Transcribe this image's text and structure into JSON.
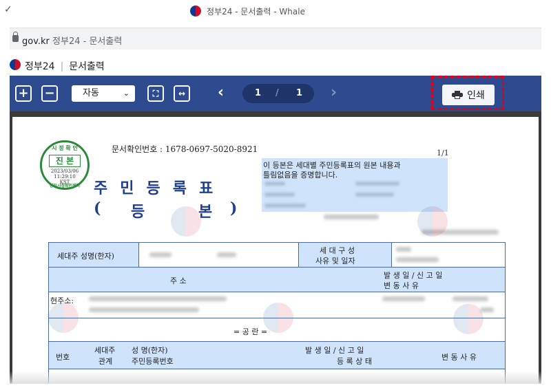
{
  "window": {
    "title": "정부24 - 문서출력 - Whale"
  },
  "address_bar": {
    "host": "gov.kr",
    "rest": " 정부24 - 문서출력"
  },
  "pdf_header": {
    "site": "정부24",
    "page": "문서출력"
  },
  "toolbar": {
    "zoom_in": "+",
    "zoom_out": "−",
    "zoom_select": "자동",
    "current_page": "1",
    "page_separator": "/",
    "total_pages": "1",
    "print_label": "인쇄"
  },
  "document": {
    "confirmation": "문서확인번호 : 1678-0697-5020-8921",
    "page_indicator": "1/1",
    "seal": {
      "top": "시 정 확 인",
      "main": "진 본",
      "date": "2023/03/06",
      "time": "11:29:10",
      "tz": "KST",
      "bottom": "정부시정확인센터"
    },
    "title": "주민등록표",
    "subtitle_open": "(",
    "subtitle_1": "등",
    "subtitle_2": "본",
    "subtitle_close": ")",
    "notice_line1": "이 등본은 세대별 주민등록표의 원본 내용과",
    "notice_line2": "틀림없음을 증명합니다.",
    "table": {
      "householder_label": "세대주 성명(한자)",
      "composition_label1": "세 대 구 성",
      "composition_label2": "사유 및 일자",
      "address_header": "주                    소",
      "date_header1": "발 생 일 / 신 고 일",
      "date_header2": "변     동     사     유",
      "current_address": "현주소:",
      "section": "=  공   란  =",
      "col_no": "번호",
      "col_relation1": "세대주",
      "col_relation2": "관계",
      "col_name1": "성  명(한자)",
      "col_name2": "주민등록번호",
      "col_date1": "발 생 일 / 신 고 일",
      "col_date2": "등 록 상 태",
      "col_reason": "변 동 사 유"
    }
  }
}
